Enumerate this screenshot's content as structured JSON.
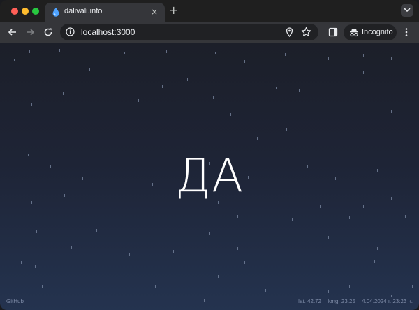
{
  "browser": {
    "tab_title": "dalivali.info",
    "tab_close": "×",
    "new_tab": "+",
    "url": "localhost:3000",
    "incognito_label": "Incognito"
  },
  "page": {
    "answer": "ДА",
    "github_link": "GitHub",
    "latitude": "lat. 42.72",
    "longitude": "long. 23.25",
    "datetime": "4.04.2024 г. 23:23 ч."
  },
  "icons": {
    "favicon": "water-drop-icon",
    "back": "arrow-left-icon",
    "forward": "arrow-right-icon",
    "reload": "reload-icon",
    "site_info": "info-icon",
    "location": "location-pin-icon",
    "bookmark": "star-icon",
    "side_panel": "side-panel-icon",
    "incognito": "incognito-icon",
    "menu": "kebab-menu-icon",
    "tab_search": "chevron-down-icon"
  },
  "colors": {
    "sky_top": "#1c1f29",
    "sky_bottom": "#24334f",
    "rain": "#7c8aa3",
    "text": "#ffffff"
  }
}
